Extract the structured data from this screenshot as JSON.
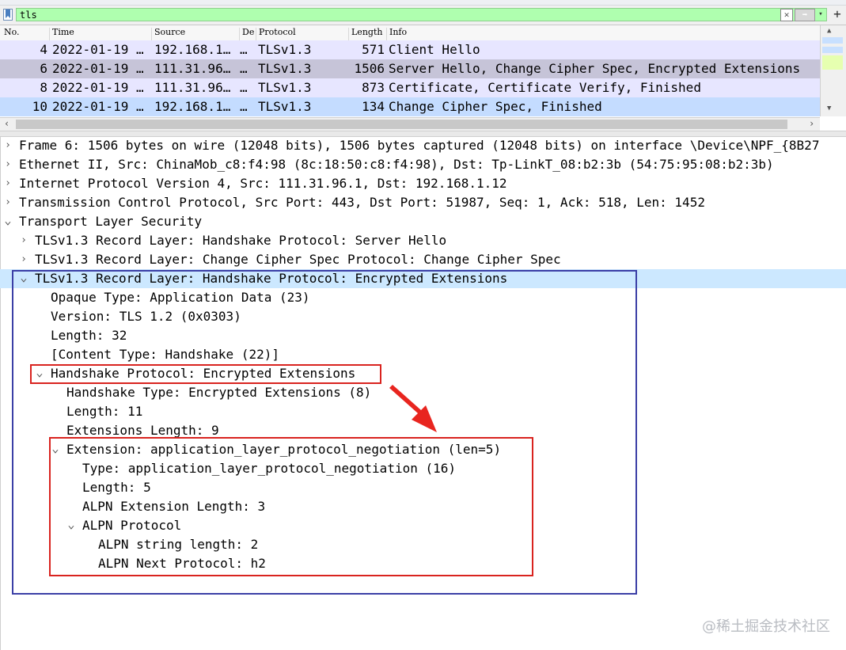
{
  "filter": {
    "value": "tls",
    "clear_icon": "✕",
    "apply_icon": "➡",
    "dropdown_icon": "▾",
    "add_icon": "+"
  },
  "packet_list": {
    "columns": [
      "No.",
      "Time",
      "Source",
      "De",
      "Protocol",
      "Length",
      "Info"
    ],
    "rows": [
      {
        "no": "4",
        "time": "2022-01-19 …",
        "source": "192.168.1…",
        "dest": "…",
        "protocol": "TLSv1.3",
        "length": "571",
        "info": "Client Hello"
      },
      {
        "no": "6",
        "time": "2022-01-19 …",
        "source": "111.31.96…",
        "dest": "…",
        "protocol": "TLSv1.3",
        "length": "1506",
        "info": "Server Hello, Change Cipher Spec, Encrypted Extensions"
      },
      {
        "no": "8",
        "time": "2022-01-19 …",
        "source": "111.31.96…",
        "dest": "…",
        "protocol": "TLSv1.3",
        "length": "873",
        "info": "Certificate, Certificate Verify, Finished"
      },
      {
        "no": "10",
        "time": "2022-01-19 …",
        "source": "192.168.1…",
        "dest": "…",
        "protocol": "TLSv1.3",
        "length": "134",
        "info": "Change Cipher Spec, Finished"
      }
    ],
    "row_colors": [
      "#e7e6ff",
      "#c6c4d8",
      "#e7e6ff",
      "#c4dcff"
    ]
  },
  "details": [
    {
      "arrow": ">",
      "text": "Frame 6: 1506 bytes on wire (12048 bits), 1506 bytes captured (12048 bits) on interface \\Device\\NPF_{8B27"
    },
    {
      "arrow": ">",
      "text": "Ethernet II, Src: ChinaMob_c8:f4:98 (8c:18:50:c8:f4:98), Dst: Tp-LinkT_08:b2:3b (54:75:95:08:b2:3b)"
    },
    {
      "arrow": ">",
      "text": "Internet Protocol Version 4, Src: 111.31.96.1, Dst: 192.168.1.12"
    },
    {
      "arrow": ">",
      "text": "Transmission Control Protocol, Src Port: 443, Dst Port: 51987, Seq: 1, Ack: 518, Len: 1452"
    },
    {
      "arrow": "v",
      "text": "Transport Layer Security"
    },
    {
      "arrow": ">",
      "text": "TLSv1.3 Record Layer: Handshake Protocol: Server Hello"
    },
    {
      "arrow": ">",
      "text": "TLSv1.3 Record Layer: Change Cipher Spec Protocol: Change Cipher Spec"
    },
    {
      "arrow": "v",
      "text": "TLSv1.3 Record Layer: Handshake Protocol: Encrypted Extensions"
    },
    {
      "arrow": "",
      "text": "Opaque Type: Application Data (23)"
    },
    {
      "arrow": "",
      "text": "Version: TLS 1.2 (0x0303)"
    },
    {
      "arrow": "",
      "text": "Length: 32"
    },
    {
      "arrow": "",
      "text": "[Content Type: Handshake (22)]"
    },
    {
      "arrow": "v",
      "text": "Handshake Protocol: Encrypted Extensions"
    },
    {
      "arrow": "",
      "text": "Handshake Type: Encrypted Extensions (8)"
    },
    {
      "arrow": "",
      "text": "Length: 11"
    },
    {
      "arrow": "",
      "text": "Extensions Length: 9"
    },
    {
      "arrow": "v",
      "text": "Extension: application_layer_protocol_negotiation (len=5)"
    },
    {
      "arrow": "",
      "text": "Type: application_layer_protocol_negotiation (16)"
    },
    {
      "arrow": "",
      "text": "Length: 5"
    },
    {
      "arrow": "",
      "text": "ALPN Extension Length: 3"
    },
    {
      "arrow": "v",
      "text": "ALPN Protocol"
    },
    {
      "arrow": "",
      "text": "ALPN string length: 2"
    },
    {
      "arrow": "",
      "text": "ALPN Next Protocol: h2"
    }
  ],
  "watermark": "@稀土掘金技术社区",
  "colors": {
    "filter_ok": "#afffaf",
    "annotation_blue": "#3b3fa6",
    "annotation_red": "#d9231f",
    "selected_detail": "#cce8ff"
  }
}
